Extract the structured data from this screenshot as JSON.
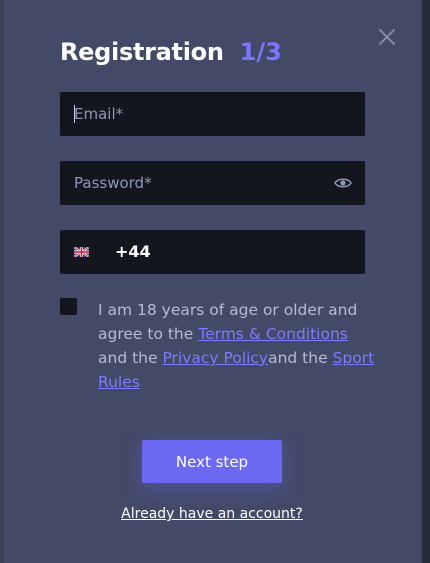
{
  "modal": {
    "title": "Registration",
    "step": "1/3"
  },
  "fields": {
    "email_placeholder": "Email*",
    "password_placeholder": "Password*",
    "phone_code": "+44",
    "phone_value": ""
  },
  "terms": {
    "prefix": "I am 18 years of age or older and agree to the ",
    "terms_link": "Terms & Conditions",
    "middle": " and the ",
    "privacy_link": "Privacy Policy",
    "middle2": "and the ",
    "sport_link": "Sport Rules",
    "checked": false
  },
  "actions": {
    "next_label": "Next step",
    "login_label": "Already have an account?"
  },
  "icons": {
    "close": "close-icon",
    "eye": "eye-icon",
    "flag": "uk-flag-icon"
  },
  "colors": {
    "modal_bg": "#434a68",
    "field_bg": "#14161f",
    "accent": "#6d68f2",
    "link": "#7c7cff"
  }
}
